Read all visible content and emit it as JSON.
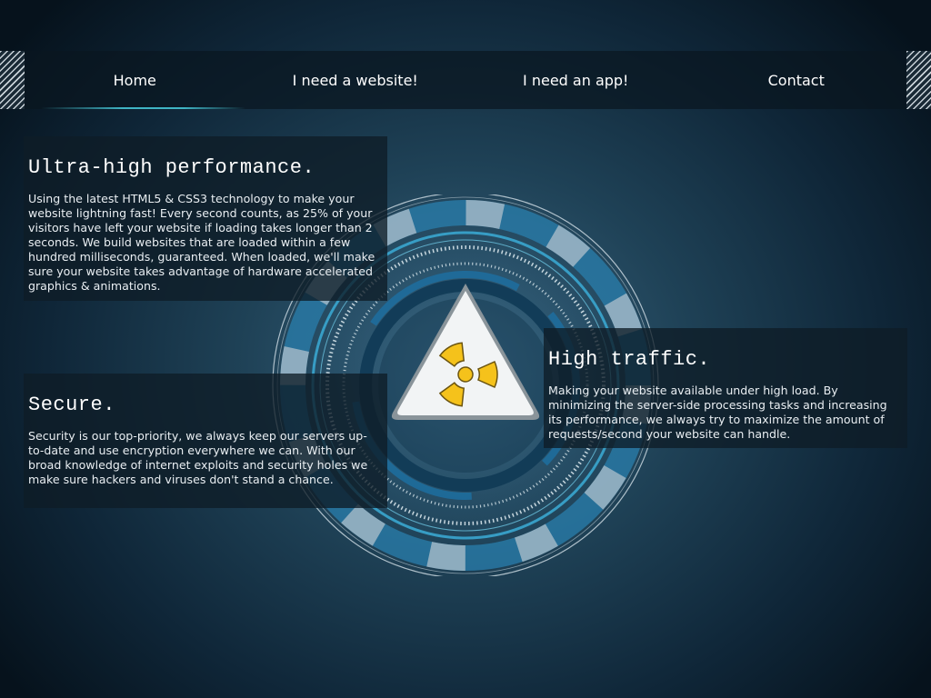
{
  "nav": {
    "items": [
      {
        "label": "Home",
        "active": true
      },
      {
        "label": "I need a website!"
      },
      {
        "label": "I need an app!"
      },
      {
        "label": "Contact"
      }
    ]
  },
  "features": {
    "performance": {
      "title": "Ultra-high performance.",
      "body": "Using the latest HTML5 & CSS3 technology to make your website lightning fast! Every second counts, as 25% of your visitors have left your website if loading takes longer than 2 seconds. We build websites that are loaded within a few hundred milliseconds, guaranteed. When loaded, we'll make sure your website takes advantage of hardware accelerated graphics & animations."
    },
    "secure": {
      "title": "Secure.",
      "body": "Security is our top-priority, we always keep our servers up-to-date and use encryption everywhere we can. With our broad knowledge of internet exploits and security holes we make sure hackers and viruses don't stand a chance."
    },
    "traffic": {
      "title": "High traffic.",
      "body": "Making your website available under high load. By minimizing the server-side processing tasks and increasing its performance, we always try to maximize the amount of requests/second your website can handle."
    }
  },
  "graphic": {
    "icon": "radiation-warning-icon",
    "colors": {
      "ring_blue": "#3aa6cf",
      "segment_gray": "#b9c6cf",
      "symbol_yellow": "#f5c21b",
      "triangle_white": "#f2f4f5"
    }
  },
  "colors": {
    "background_center": "#3a6580",
    "background_edge": "#06121c",
    "nav_underline": "#3fb4c4",
    "panel_bg": "#0e1c26"
  }
}
